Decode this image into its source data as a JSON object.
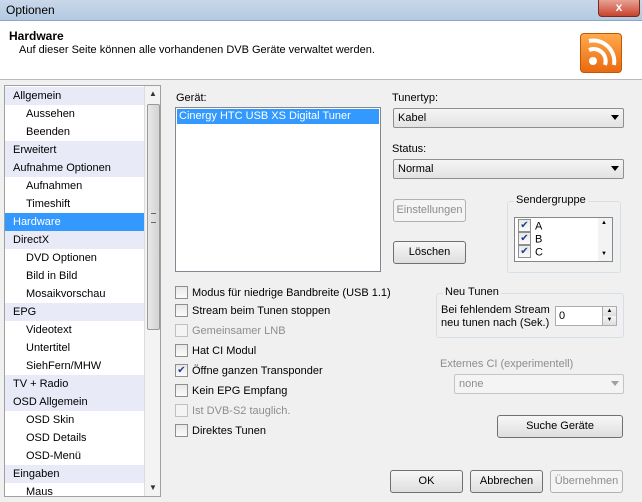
{
  "window": {
    "title": "Optionen",
    "close": "x"
  },
  "header": {
    "title": "Hardware",
    "subtitle": "Auf dieser Seite können alle vorhandenen DVB Geräte verwaltet werden."
  },
  "nav": {
    "items": [
      {
        "label": "Allgemein",
        "level": "cat"
      },
      {
        "label": "Aussehen",
        "level": "sub"
      },
      {
        "label": "Beenden",
        "level": "sub"
      },
      {
        "label": "Erweitert",
        "level": "cat"
      },
      {
        "label": "Aufnahme Optionen",
        "level": "cat"
      },
      {
        "label": "Aufnahmen",
        "level": "sub"
      },
      {
        "label": "Timeshift",
        "level": "sub"
      },
      {
        "label": "Hardware",
        "level": "cat",
        "selected": true
      },
      {
        "label": "DirectX",
        "level": "cat"
      },
      {
        "label": "DVD Optionen",
        "level": "sub"
      },
      {
        "label": "Bild in Bild",
        "level": "sub"
      },
      {
        "label": "Mosaikvorschau",
        "level": "sub"
      },
      {
        "label": "EPG",
        "level": "cat"
      },
      {
        "label": "Videotext",
        "level": "sub"
      },
      {
        "label": "Untertitel",
        "level": "sub"
      },
      {
        "label": "SiehFern/MHW",
        "level": "sub"
      },
      {
        "label": "TV + Radio",
        "level": "cat"
      },
      {
        "label": "OSD Allgemein",
        "level": "cat"
      },
      {
        "label": "OSD Skin",
        "level": "sub"
      },
      {
        "label": "OSD Details",
        "level": "sub"
      },
      {
        "label": "OSD-Menü",
        "level": "sub"
      },
      {
        "label": "Eingaben",
        "level": "cat"
      },
      {
        "label": "Maus",
        "level": "sub"
      }
    ]
  },
  "device": {
    "label": "Gerät:",
    "items": [
      "Cinergy HTC USB XS Digital Tuner"
    ]
  },
  "tuner": {
    "label": "Tunertyp:",
    "value": "Kabel"
  },
  "status": {
    "label": "Status:",
    "value": "Normal"
  },
  "buttons": {
    "settings": "Einstellungen",
    "delete": "Löschen",
    "search": "Suche Geräte",
    "ok": "OK",
    "cancel": "Abbrechen",
    "apply": "Übernehmen"
  },
  "sendergruppe": {
    "title": "Sendergruppe",
    "items": [
      "A",
      "B",
      "C"
    ]
  },
  "options": [
    {
      "label": "Modus für niedrige Bandbreite (USB 1.1)",
      "checked": false,
      "enabled": true
    },
    {
      "label": "Stream beim Tunen stoppen",
      "checked": false,
      "enabled": true
    },
    {
      "label": "Gemeinsamer LNB",
      "checked": false,
      "enabled": false
    },
    {
      "label": "Hat CI Modul",
      "checked": false,
      "enabled": true
    },
    {
      "label": "Öffne ganzen Transponder",
      "checked": true,
      "enabled": true
    },
    {
      "label": "Kein EPG Empfang",
      "checked": false,
      "enabled": true
    },
    {
      "label": "Ist DVB-S2 tauglich.",
      "checked": false,
      "enabled": false
    },
    {
      "label": "Direktes Tunen",
      "checked": false,
      "enabled": true
    }
  ],
  "retune": {
    "title": "Neu Tunen",
    "text_line1": "Bei fehlendem Stream",
    "text_line2": "neu tunen nach (Sek.)",
    "value": "0"
  },
  "externalCI": {
    "title": "Externes CI (experimentell)",
    "value": "none"
  }
}
